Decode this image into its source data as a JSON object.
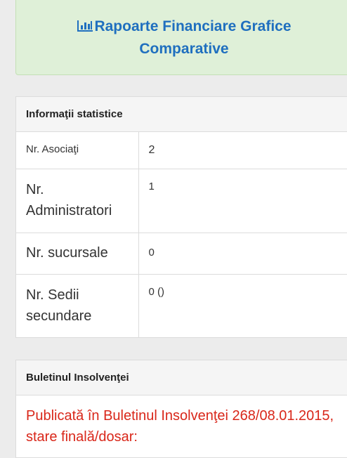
{
  "banner": {
    "link_text": "Rapoarte Financiare Grafice Comparative",
    "icon": "bar-chart-icon"
  },
  "stats": {
    "heading": "Informaţii statistice",
    "rows": [
      {
        "label": "Nr. Asociaţi",
        "value": "2"
      },
      {
        "label": "Nr. Administratori",
        "value": "1"
      },
      {
        "label": "Nr. sucursale",
        "value": "0"
      },
      {
        "label": "Nr. Sedii secundare",
        "value": "0 ()"
      }
    ]
  },
  "insolvency": {
    "heading": "Buletinul Insolvenţei",
    "text": "Publicată în Buletinul Insolvenţei 268/08.01.2015, stare finală/dosar:"
  },
  "colors": {
    "link": "#1f6fbf",
    "banner_bg": "#dff0d8",
    "alert_text": "#d9271a"
  }
}
